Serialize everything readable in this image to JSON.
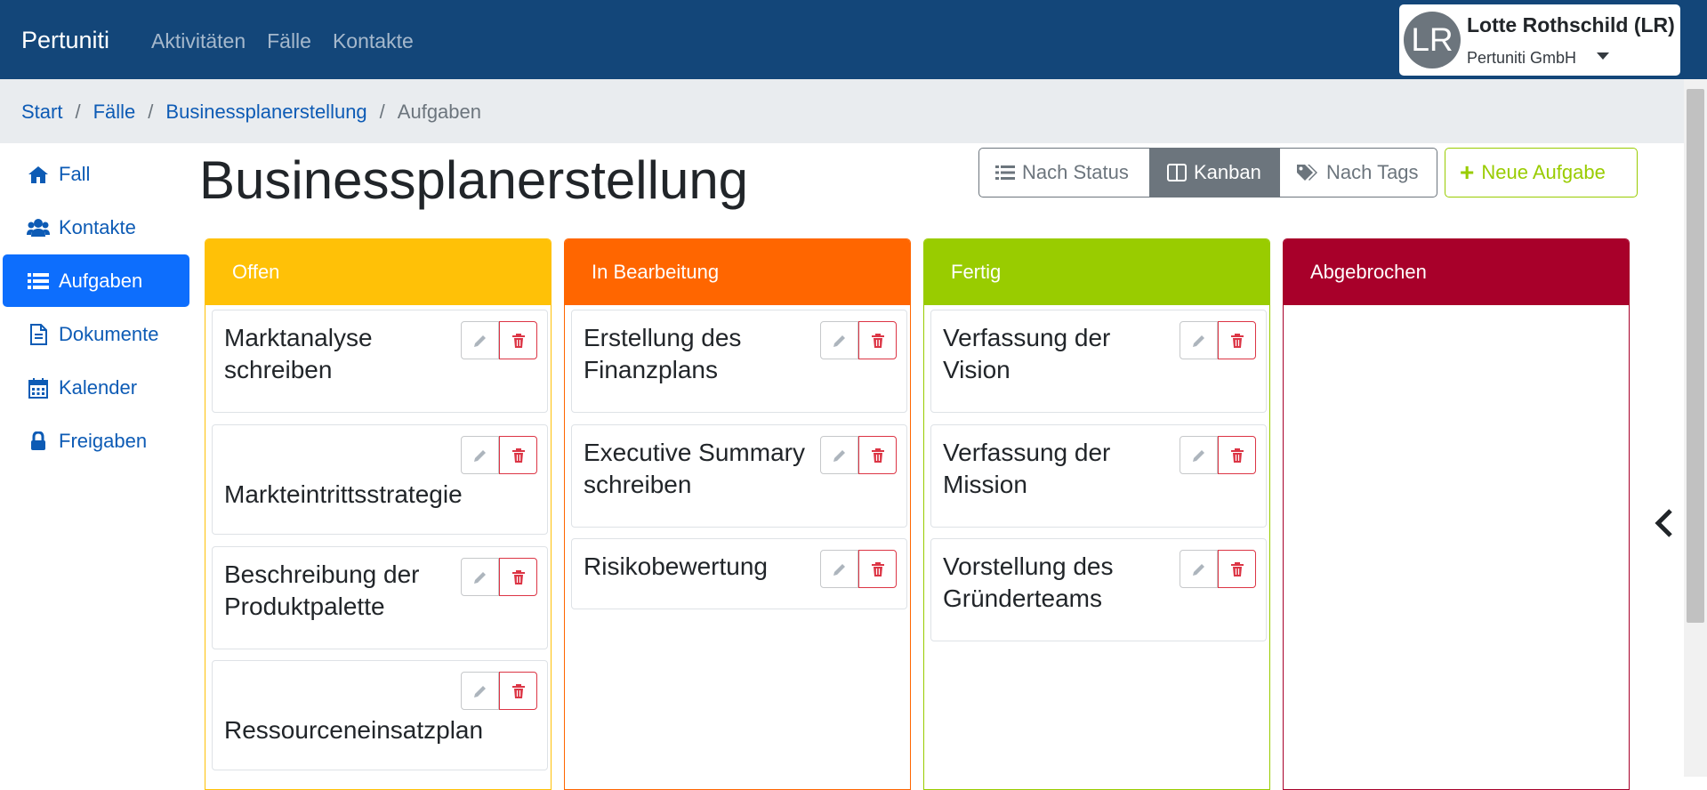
{
  "navbar": {
    "brand": "Pertuniti",
    "links": [
      "Aktivitäten",
      "Fälle",
      "Kontakte"
    ]
  },
  "user": {
    "initials": "LR",
    "name": "Lotte Rothschild (LR)",
    "org": "Pertuniti GmbH"
  },
  "breadcrumb": {
    "items": [
      "Start",
      "Fälle",
      "Businessplanerstellung"
    ],
    "current": "Aufgaben",
    "separator": "/"
  },
  "sidebar": {
    "items": [
      {
        "label": "Fall",
        "icon": "home-icon"
      },
      {
        "label": "Kontakte",
        "icon": "users-icon"
      },
      {
        "label": "Aufgaben",
        "icon": "list-icon",
        "active": true
      },
      {
        "label": "Dokumente",
        "icon": "document-icon"
      },
      {
        "label": "Kalender",
        "icon": "calendar-icon"
      },
      {
        "label": "Freigaben",
        "icon": "lock-icon"
      }
    ]
  },
  "page": {
    "title": "Businessplanerstellung"
  },
  "views": {
    "status": "Nach Status",
    "kanban": "Kanban",
    "tags": "Nach Tags",
    "new_task": "Neue Aufgabe"
  },
  "columns": [
    {
      "title": "Offen",
      "color": "#ffc107",
      "tasks": [
        "Marktanalyse schreiben",
        "Markteintrittsstrategie",
        "Beschreibung der Produktpalette",
        "Ressourceneinsatzplan"
      ]
    },
    {
      "title": "In Bearbeitung",
      "color": "#ff6600",
      "tasks": [
        "Erstellung des Finanzplans",
        "Executive Summary schreiben",
        "Risikobewertung"
      ]
    },
    {
      "title": "Fertig",
      "color": "#99cc00",
      "tasks": [
        "Verfassung der Vision",
        "Verfassung der Mission",
        "Vorstellung des Gründerteams"
      ]
    },
    {
      "title": "Abgebrochen",
      "color": "#a8002a",
      "tasks": []
    }
  ],
  "colors": {
    "navbar": "#134679",
    "link": "#0d5bb5",
    "active": "#0d6efd",
    "delete": "#dc3545"
  }
}
